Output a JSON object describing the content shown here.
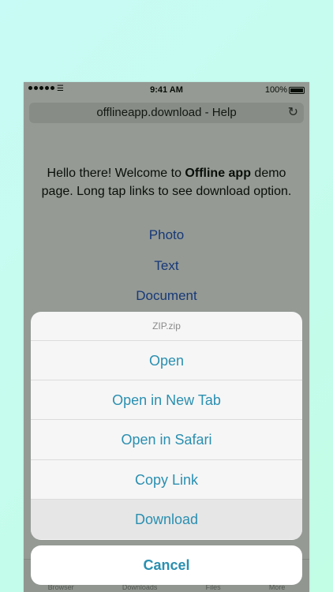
{
  "status_bar": {
    "time": "9:41 AM",
    "battery": "100%",
    "wifi_icon": "wifi-icon"
  },
  "browser": {
    "url_title": "offlineapp.download - Help",
    "reload_icon": "reload-icon"
  },
  "page": {
    "welcome_prefix": "Hello there! Welcome to ",
    "welcome_bold": "Offline app",
    "welcome_suffix": " demo page. Long tap links to see download option.",
    "links": [
      "Photo",
      "Text",
      "Document"
    ]
  },
  "tab_bar": [
    "Browser",
    "Downloads",
    "Files",
    "More"
  ],
  "action_sheet": {
    "title": "ZIP.zip",
    "actions": [
      "Open",
      "Open in New Tab",
      "Open in Safari",
      "Copy Link",
      "Download"
    ],
    "cancel": "Cancel"
  },
  "colors": {
    "accent": "#2a8fb0",
    "link": "#1b4fc8",
    "background": "#c4fcee"
  }
}
